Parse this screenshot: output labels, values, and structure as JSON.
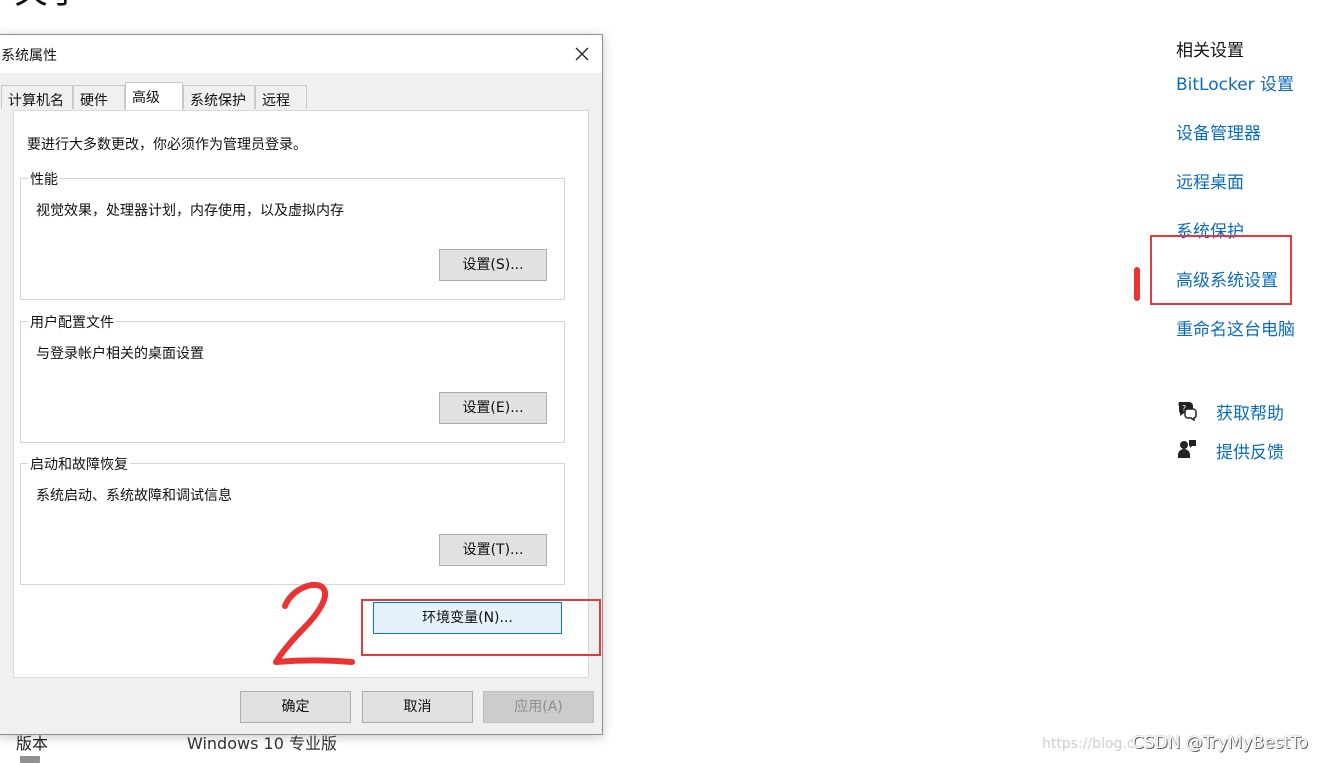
{
  "background": {
    "heading": "关于",
    "bottom_label": "版本",
    "bottom_value": "Windows 10 专业版"
  },
  "related_settings": {
    "title": "相关设置",
    "links": [
      "BitLocker 设置",
      "设备管理器",
      "远程桌面",
      "系统保护",
      "高级系统设置",
      "重命名这台电脑"
    ],
    "help": "获取帮助",
    "feedback": "提供反馈"
  },
  "dialog": {
    "title": "系统属性",
    "tabs": [
      "计算机名",
      "硬件",
      "高级",
      "系统保护",
      "远程"
    ],
    "active_tab": "高级",
    "admin_note": "要进行大多数更改，你必须作为管理员登录。",
    "performance": {
      "legend": "性能",
      "description": "视觉效果，处理器计划，内存使用，以及虚拟内存",
      "button": "设置(S)..."
    },
    "user_profiles": {
      "legend": "用户配置文件",
      "description": "与登录帐户相关的桌面设置",
      "button": "设置(E)..."
    },
    "startup_recovery": {
      "legend": "启动和故障恢复",
      "description": "系统启动、系统故障和调试信息",
      "button": "设置(T)..."
    },
    "env_button": "环境变量(N)...",
    "footer": {
      "ok": "确定",
      "cancel": "取消",
      "apply": "应用(A)"
    }
  },
  "watermark": {
    "faint": "https://blog.c",
    "text": "CSDN @TryMyBestTo"
  },
  "colors": {
    "link": "#0a6cbd",
    "annotation": "#e23b3b",
    "dialog_bg": "#f0f0f0",
    "default_button_border": "#0078d7"
  }
}
